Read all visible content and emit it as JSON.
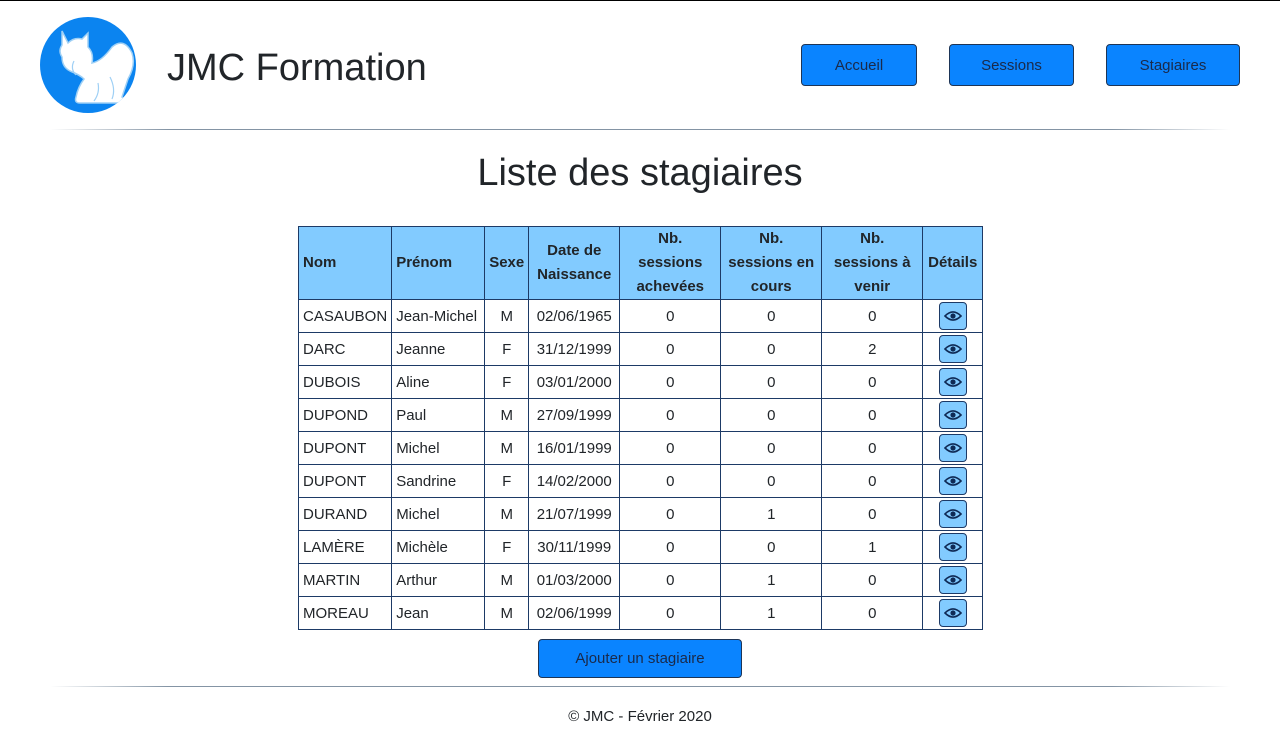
{
  "header": {
    "site_title": "JMC Formation",
    "nav": {
      "accueil": "Accueil",
      "sessions": "Sessions",
      "stagiaires": "Stagiaires"
    }
  },
  "main": {
    "title": "Liste des stagiaires",
    "table": {
      "columns": [
        "Nom",
        "Prénom",
        "Sexe",
        "Date de Naissance",
        "Nb. sessions achevées",
        "Nb. sessions en cours",
        "Nb. sessions à venir",
        "Détails"
      ],
      "rows": [
        [
          "CASAUBON",
          "Jean-Michel",
          "M",
          "02/06/1965",
          "0",
          "0",
          "0"
        ],
        [
          "DARC",
          "Jeanne",
          "F",
          "31/12/1999",
          "0",
          "0",
          "2"
        ],
        [
          "DUBOIS",
          "Aline",
          "F",
          "03/01/2000",
          "0",
          "0",
          "0"
        ],
        [
          "DUPOND",
          "Paul",
          "M",
          "27/09/1999",
          "0",
          "0",
          "0"
        ],
        [
          "DUPONT",
          "Michel",
          "M",
          "16/01/1999",
          "0",
          "0",
          "0"
        ],
        [
          "DUPONT",
          "Sandrine",
          "F",
          "14/02/2000",
          "0",
          "0",
          "0"
        ],
        [
          "DURAND",
          "Michel",
          "M",
          "21/07/1999",
          "0",
          "1",
          "0"
        ],
        [
          "LAMÈRE",
          "Michèle",
          "F",
          "30/11/1999",
          "0",
          "0",
          "1"
        ],
        [
          "MARTIN",
          "Arthur",
          "M",
          "01/03/2000",
          "0",
          "1",
          "0"
        ],
        [
          "MOREAU",
          "Jean",
          "M",
          "02/06/1999",
          "0",
          "1",
          "0"
        ]
      ]
    },
    "add_button": "Ajouter un stagiaire"
  },
  "footer": {
    "text": "© JMC - Février 2020"
  },
  "colors": {
    "accent": "#0a84ff",
    "header_cell": "#82cbff",
    "logo_bg": "#0b84f0"
  }
}
